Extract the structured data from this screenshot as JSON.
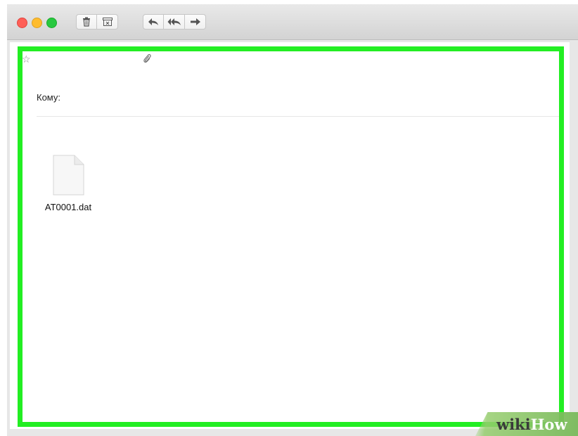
{
  "toolbar": {
    "traffic_lights": [
      "close",
      "minimize",
      "zoom"
    ],
    "buttons": [
      {
        "icon": "trash-icon"
      },
      {
        "icon": "archive-icon"
      },
      {
        "icon": "reply-icon"
      },
      {
        "icon": "reply-all-icon"
      },
      {
        "icon": "forward-icon"
      }
    ]
  },
  "message": {
    "star_glyph": "☆",
    "to_label": "Кому:",
    "attachment": {
      "icon": "file-icon",
      "filename": "AT0001.dat"
    }
  },
  "highlight_color": "#22ee22",
  "watermark": {
    "part1": "wiki",
    "part2": "How"
  }
}
